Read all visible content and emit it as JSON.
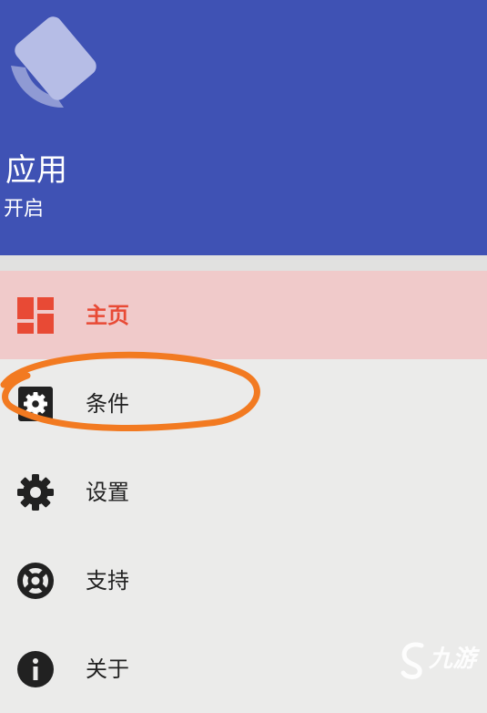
{
  "header": {
    "app_title": "应用",
    "status": "开启"
  },
  "colors": {
    "header_bg": "#3f52b4",
    "gap_band": "#e1e1e0",
    "page_bg": "#ebebea",
    "selected_bg": "#f0caca",
    "selected_text": "#e84a35",
    "text": "#212121",
    "annotation": "#f27a21"
  },
  "menu": {
    "items": [
      {
        "label": "主页",
        "icon": "dashboard-icon",
        "selected": true
      },
      {
        "label": "条件",
        "icon": "gear-box-icon",
        "selected": false
      },
      {
        "label": "设置",
        "icon": "gear-icon",
        "selected": false
      },
      {
        "label": "支持",
        "icon": "lifebuoy-icon",
        "selected": false
      },
      {
        "label": "关于",
        "icon": "info-icon",
        "selected": false
      }
    ]
  },
  "watermark": {
    "text": "九游"
  }
}
